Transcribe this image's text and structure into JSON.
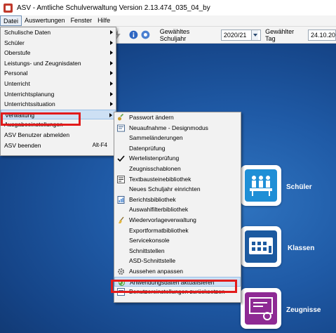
{
  "window": {
    "title": "ASV - Amtliche Schulverwaltung Version 2.13.474_035_04_by"
  },
  "menubar": [
    {
      "label": "Datei",
      "active": true
    },
    {
      "label": "Auswertungen",
      "active": false
    },
    {
      "label": "Fenster",
      "active": false
    },
    {
      "label": "Hilfe",
      "active": false
    }
  ],
  "toolbar": {
    "schuljahr_label": "Gewähltes Schuljahr",
    "schuljahr_value": "2020/21",
    "tag_label": "Gewählter Tag",
    "tag_value": "24.10.20"
  },
  "datei_menu": [
    {
      "label": "Schulische Daten",
      "submenu": true
    },
    {
      "label": "Schüler",
      "submenu": true
    },
    {
      "label": "Oberstufe",
      "submenu": true
    },
    {
      "label": "Leistungs- und Zeugnisdaten",
      "submenu": true
    },
    {
      "label": "Personal",
      "submenu": true
    },
    {
      "label": "Unterricht",
      "submenu": true
    },
    {
      "label": "Unterrichtsplanung",
      "submenu": true
    },
    {
      "label": "Unterrichtssituation",
      "submenu": true
    },
    {
      "label": "Verwaltung",
      "submenu": true,
      "highlighted": true
    },
    {
      "label": "Ausgabeeinstellungen",
      "submenu": false
    },
    {
      "label": "ASV Benutzer abmelden",
      "submenu": false
    },
    {
      "label": "ASV beenden",
      "submenu": false,
      "shortcut": "Alt-F4"
    }
  ],
  "verwaltung_menu": [
    {
      "label": "Passwort ändern",
      "icon": "key-icon"
    },
    {
      "label": "Neuaufnahme - Designmodus",
      "icon": "form-icon"
    },
    {
      "label": "Sammeländerungen",
      "icon": ""
    },
    {
      "label": "Datenprüfung",
      "icon": ""
    },
    {
      "label": "Wertelistenprüfung",
      "icon": "checkmark-icon"
    },
    {
      "label": "Zeugnisschablonen",
      "icon": ""
    },
    {
      "label": "Textbausteinebibliothek",
      "icon": "text-block-icon"
    },
    {
      "label": "Neues Schuljahr einrichten",
      "icon": ""
    },
    {
      "label": "Berichtsbibliothek",
      "icon": "report-icon"
    },
    {
      "label": "Auswahlfilterbibliothek",
      "icon": ""
    },
    {
      "label": "Wiedervorlageverwaltung",
      "icon": "broom-icon"
    },
    {
      "label": "Exportformatbibliothek",
      "icon": ""
    },
    {
      "label": "Servicekonsole",
      "icon": ""
    },
    {
      "label": "Schnittstellen",
      "icon": ""
    },
    {
      "label": "ASD-Schnittstelle",
      "icon": ""
    },
    {
      "label": "Aussehen anpassen",
      "icon": "gear-icon"
    },
    {
      "label": "Anwendungsdaten aktualisieren",
      "icon": "refresh-icon",
      "highlighted": true
    },
    {
      "label": "Benutzereinstellungen zurücksetzen",
      "icon": "reset-icon"
    }
  ],
  "tiles": [
    {
      "label": "Schüler",
      "color": "#1f8fd6",
      "icon": "students-icon"
    },
    {
      "label": "Klassen",
      "color": "#1c5aa0",
      "icon": "classroom-icon"
    },
    {
      "label": "Zeugnisse",
      "color": "#8e2a94",
      "icon": "certificate-icon"
    }
  ],
  "colors": {
    "highlight_box": "#e21b1b",
    "menu_hover": "#cde0f4",
    "desktop": "#1f5aa6"
  }
}
